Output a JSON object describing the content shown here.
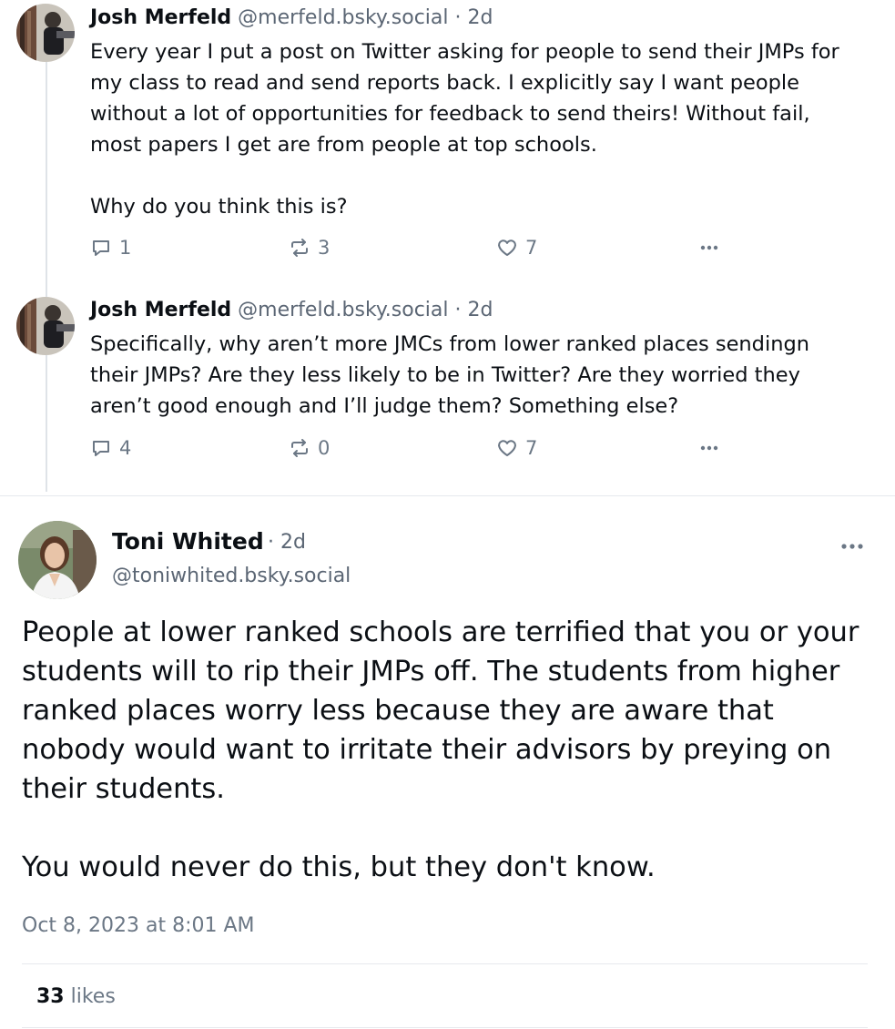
{
  "posts": [
    {
      "author_name": "Josh Merfeld",
      "handle": "@merfeld.bsky.social",
      "separator": "·",
      "time": "2d",
      "paragraphs": [
        "Every year I put a post on Twitter asking for people to send their JMPs for my class to read and send reports back. I explicitly say I want people without a lot of opportunities for feedback to send theirs! Without fail, most papers I get are from people at top schools.",
        "Why do you think this is?"
      ],
      "replies": "1",
      "reposts": "3",
      "likes": "7",
      "icons": [
        "reply-icon",
        "repost-icon",
        "heart-icon",
        "more-icon"
      ]
    },
    {
      "author_name": "Josh Merfeld",
      "handle": "@merfeld.bsky.social",
      "separator": "·",
      "time": "2d",
      "paragraphs": [
        "Specifically, why aren’t more JMCs from lower ranked places sendingn their JMPs? Are they less likely to be in Twitter? Are they worried they aren’t good enough and I’ll judge them? Something else?"
      ],
      "replies": "4",
      "reposts": "0",
      "likes": "7",
      "icons": [
        "reply-icon",
        "repost-icon",
        "heart-icon",
        "more-icon"
      ]
    }
  ],
  "main_post": {
    "author_name": "Toni Whited",
    "separator": "·",
    "time": "2d",
    "handle": "@toniwhited.bsky.social",
    "paragraphs": [
      "People at lower ranked schools are terrified that you or your students will to rip their JMPs off. The students from higher ranked places worry less because they are aware that nobody would want to irritate their advisors by preying on their students.",
      "You would never do this, but they don't know."
    ],
    "date": "Oct 8, 2023 at 8:01 AM",
    "likes_count": "33",
    "likes_label": "likes"
  },
  "colors": {
    "text": "#0b0f14",
    "muted": "#6b7785",
    "thread_line": "#dfe3e8",
    "divider": "#e6e9ed"
  }
}
